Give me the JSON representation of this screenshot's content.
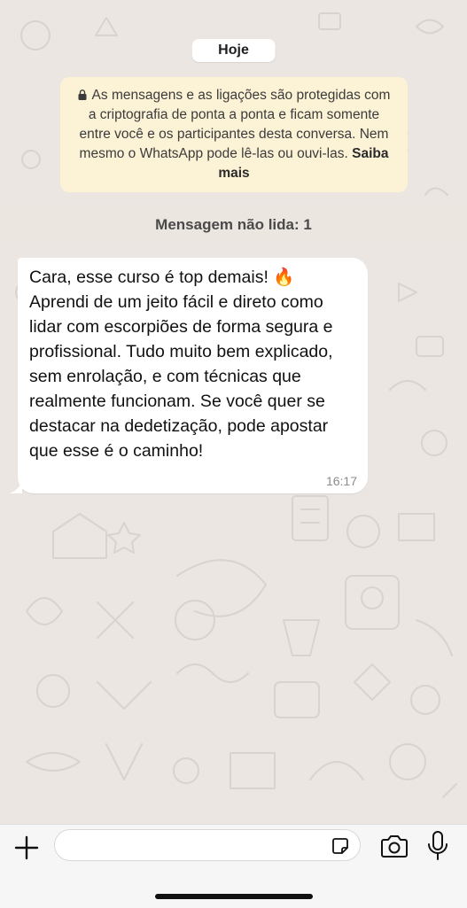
{
  "chat": {
    "date_label": "Hoje",
    "encryption_notice": {
      "text": "As mensagens e as ligações são protegidas com a criptografia de ponta a ponta e ficam somente entre você e os participantes desta conversa. Nem mesmo o WhatsApp pode lê-las ou ouvi-las.",
      "link": "Saiba mais"
    },
    "unread_label": "Mensagem não lida: 1",
    "messages": [
      {
        "text": "Cara, esse curso é top demais! 🔥 Aprendi de um jeito fácil e direto como lidar com escorpiões de forma segura e profissional. Tudo muito bem explicado, sem enrolação, e com técnicas que realmente funcionam. Se você quer se destacar na dedetização, pode apostar que esse é o caminho!",
        "time": "16:17"
      }
    ]
  },
  "composer": {
    "input_value": "",
    "icons": {
      "plus": "plus-icon",
      "sticker": "sticker-icon",
      "camera": "camera-icon",
      "mic": "microphone-icon"
    }
  },
  "colors": {
    "chat_background": "#ebe6e1",
    "notice_background": "#fcf2d5",
    "bubble_background": "#ffffff",
    "bottom_bar": "#f6f6f6"
  }
}
